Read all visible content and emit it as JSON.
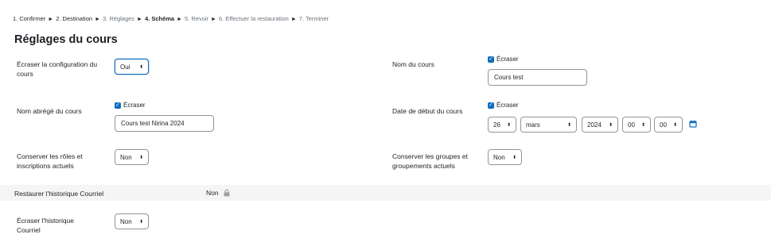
{
  "stepper": {
    "steps": [
      {
        "label": "1. Confirmer"
      },
      {
        "label": "2. Destination"
      },
      {
        "label": "3. Réglages"
      },
      {
        "label": "4. Schéma"
      },
      {
        "label": "5. Revoir"
      },
      {
        "label": "6. Effectuer la restauration"
      },
      {
        "label": "7. Terminer"
      }
    ],
    "separator": "►"
  },
  "section_title": "Réglages du cours",
  "settings": {
    "overwrite_config": {
      "label": "Écraser la configuration du cours",
      "value": "Oui"
    },
    "course_name": {
      "label": "Nom du cours",
      "overwrite_label": "Écraser",
      "value": "Cours test"
    },
    "short_name": {
      "label": "Nom abrégé du cours",
      "overwrite_label": "Écraser",
      "value": "Cours test Nirina 2024"
    },
    "start_date": {
      "label": "Date de début du cours",
      "overwrite_label": "Écraser",
      "day": "26",
      "month": "mars",
      "year": "2024",
      "hour": "00",
      "minute": "00"
    },
    "keep_roles": {
      "label": "Conserver les rôles et inscriptions actuels",
      "value": "Non"
    },
    "keep_groups": {
      "label": "Conserver les groupes et groupements actuels",
      "value": "Non"
    },
    "restore_mail_history": {
      "label": "Restaurer l'historique Courriel",
      "value": "Non"
    },
    "overwrite_mail_history": {
      "label": "Écraser l'historique Courriel",
      "value": "Non"
    }
  },
  "icons": {
    "dropdown": "⬍",
    "checkbox": "✓",
    "calendar": "calendar-icon",
    "locked": "lock-icon"
  },
  "colors": {
    "accent": "#0f6cbf",
    "text": "#1d2125",
    "muted": "#6a737b",
    "band": "#f5f5f5"
  }
}
